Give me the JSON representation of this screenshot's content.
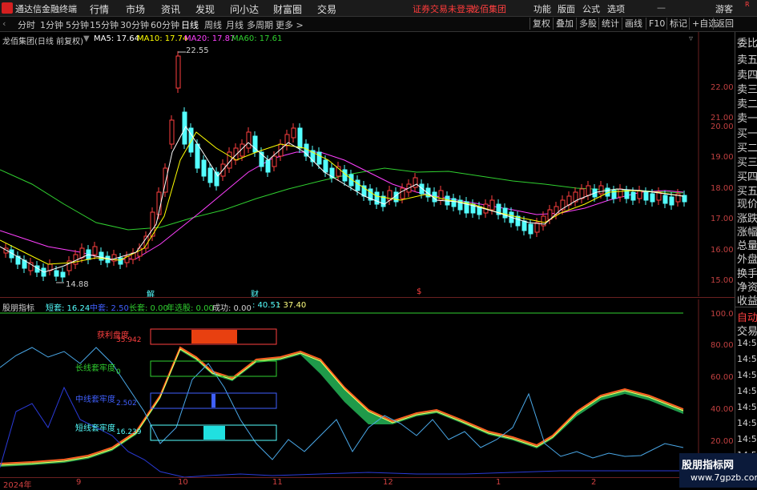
{
  "app_title": "通达信金融终端",
  "menu": [
    "行情",
    "市场",
    "资讯",
    "发现",
    "问小达",
    "财富圈",
    "交易"
  ],
  "warning": "证券交易未登录",
  "stock_name_top": "龙佰集团",
  "top_right": [
    "功能",
    "版面",
    "公式",
    "选项"
  ],
  "guest": "游客",
  "periods": [
    "分时",
    "1分钟",
    "5分钟",
    "15分钟",
    "30分钟",
    "60分钟",
    "日线",
    "周线",
    "月线",
    "多周期",
    "更多 >"
  ],
  "active_period": "日线",
  "right_buttons": [
    "复权",
    "叠加",
    "多股",
    "统计",
    "画线",
    "F10",
    "标记",
    "+自选",
    "返回"
  ],
  "main_title": {
    "name": "龙佰集团(日线 前复权)",
    "ma5": "MA5: 17.64",
    "ma10": "MA10: 17.74",
    "ma20": "MA20: 17.87",
    "ma60": "MA60: 17.61"
  },
  "price_ticks": [
    "22.00",
    "21.00",
    "20.00",
    "19.00",
    "18.00",
    "17.00",
    "16.00",
    "15.00"
  ],
  "hi_label": "22.55",
  "lo_label": "14.88",
  "event_markers": [
    "解",
    "财"
  ],
  "sub_title": {
    "name": "股朋指标",
    "short": "短套: 16.24",
    "mid": "中套: 2.50",
    "long": "长套: 0.00",
    "year": "年选股: 0.00",
    "success": "成功: 0.00",
    "v1": ": 40.51",
    "v2": ": 37.40"
  },
  "sub_ticks": [
    "100.0",
    "80.00",
    "60.00",
    "40.00",
    "20.00"
  ],
  "boxes": [
    {
      "label": "获利盘度",
      "value": "35.942"
    },
    {
      "label": "长线套牢度",
      "value": "0"
    },
    {
      "label": "中线套牢度",
      "value": "2.502"
    },
    {
      "label": "短线套牢度",
      "value": "16.239"
    }
  ],
  "x_labels": [
    "2024年",
    "9",
    "10",
    "11",
    "12",
    "1",
    "2"
  ],
  "right_labels": [
    "委比",
    "卖五",
    "卖四",
    "卖三",
    "卖二",
    "卖一",
    "买一",
    "买二",
    "买三",
    "买四",
    "买五",
    "现价",
    "涨跌",
    "涨幅",
    "总量",
    "外盘",
    "换手",
    "净资",
    "收益"
  ],
  "right_labels2": [
    "自动",
    "交易",
    "14:56",
    "14:56",
    "14:56",
    "14:56",
    "14:56",
    "14:56",
    "14:56",
    "14:56"
  ],
  "watermark": {
    "line1": "股朋指标网",
    "line2": "www.7gpzb.com"
  },
  "colors": {
    "up": "#ff4040",
    "down": "#54ffff",
    "ma5": "#ffffff",
    "ma10": "#ffff00",
    "ma20": "#ff40ff",
    "ma60": "#30d030"
  }
}
